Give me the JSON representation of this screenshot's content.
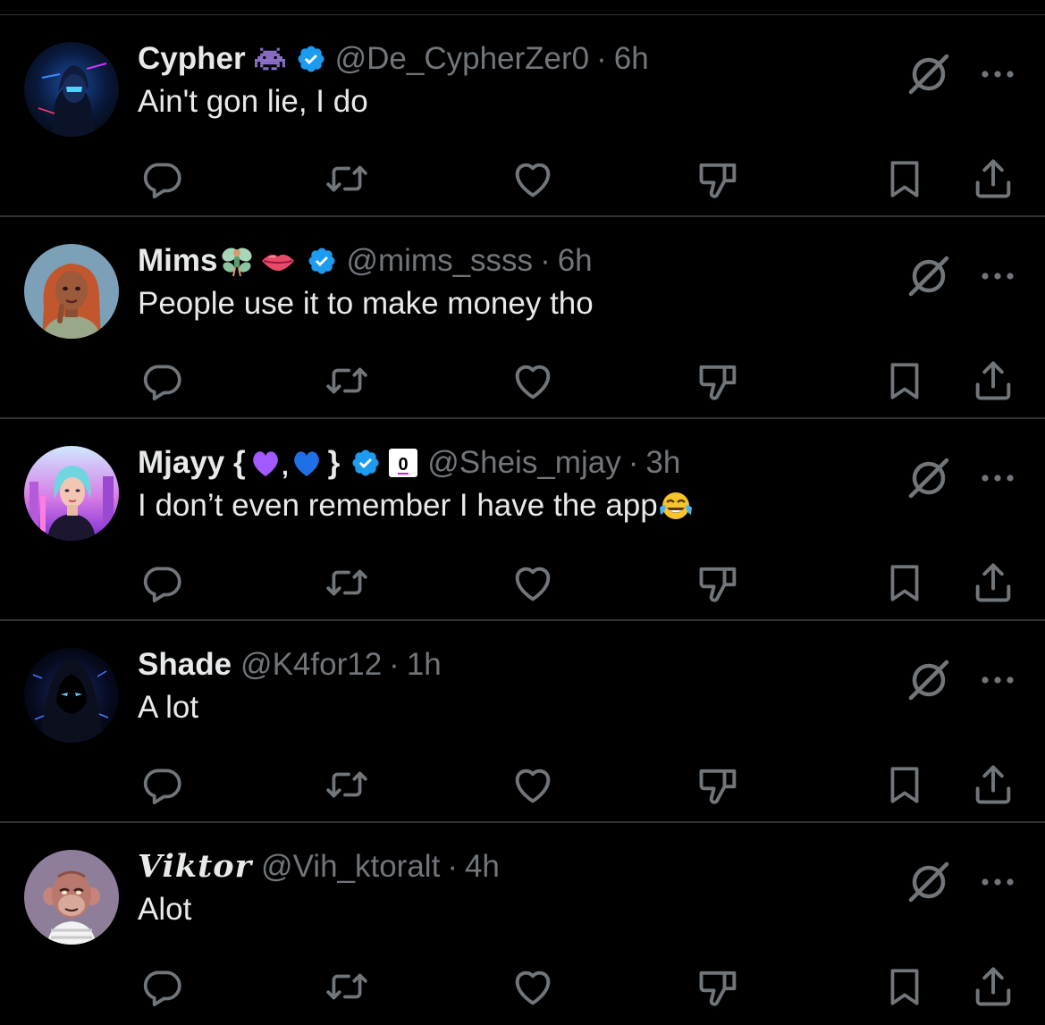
{
  "colors": {
    "background": "#000000",
    "text_primary": "#e7e9ea",
    "text_secondary": "#71767b",
    "divider": "#2f3336",
    "verified_blue": "#1d9bf0"
  },
  "icons": {
    "reply": "reply-icon",
    "repost": "repost-icon",
    "like": "heart-icon",
    "dislike": "thumbs-down-icon",
    "bookmark": "bookmark-icon",
    "share": "share-icon",
    "grok": "grok-icon",
    "more": "more-icon"
  },
  "replies": [
    {
      "display_name": "Cypher",
      "name_emoji": "👾",
      "verified": true,
      "handle": "@De_CypherZer0",
      "separator": "·",
      "time": "6h",
      "text": "Ain't gon lie, I do"
    },
    {
      "display_name": "Mims",
      "name_emoji": "🧚👄",
      "verified": true,
      "handle": "@mims_ssss",
      "separator": "·",
      "time": "6h",
      "text": "People use it to make money tho"
    },
    {
      "display_name": "Mjayy {",
      "name_emoji": "💜,💙",
      "name_suffix": "}",
      "verified": true,
      "affiliate_badge": "0",
      "handle": "@Sheis_mjay",
      "separator": "·",
      "time": "3h",
      "text": "I don’t even remember I have the app",
      "text_emoji": "😂"
    },
    {
      "display_name": "Shade",
      "verified": false,
      "handle": "@K4for12",
      "separator": "·",
      "time": "1h",
      "text": "A lot"
    },
    {
      "display_name": "Viktor",
      "verified": false,
      "handle": "@Vih_ktoralt",
      "separator": "·",
      "time": "4h",
      "text": "Alot"
    }
  ]
}
